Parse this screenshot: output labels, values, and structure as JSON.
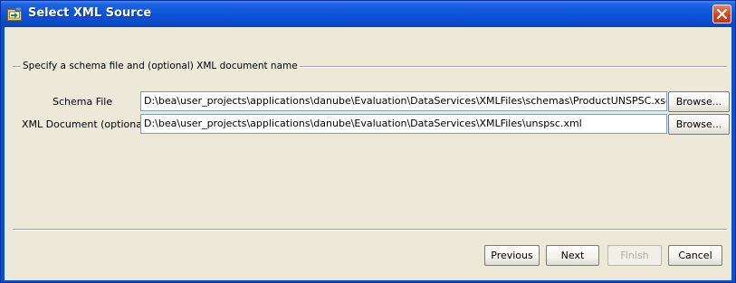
{
  "window": {
    "title": "Select XML Source",
    "icon": "wizard-icon",
    "close_icon": "close-icon"
  },
  "group": {
    "title": "Specify a schema file and (optional) XML document name"
  },
  "fields": {
    "schema": {
      "label": "Schema File",
      "value": "D:\\bea\\user_projects\\applications\\danube\\Evaluation\\DataServices\\XMLFiles\\schemas\\ProductUNSPSC.xsd",
      "browse_label": "Browse..."
    },
    "xml_document": {
      "label": "XML Document (optional)",
      "value": "D:\\bea\\user_projects\\applications\\danube\\Evaluation\\DataServices\\XMLFiles\\unspsc.xml",
      "browse_label": "Browse..."
    }
  },
  "buttons": {
    "previous": "Previous",
    "next": "Next",
    "finish": "Finish",
    "cancel": "Cancel"
  },
  "colors": {
    "titlebar": "#0a4cc8",
    "dialog_background": "#ece9d8",
    "close_button": "#d2451f"
  }
}
